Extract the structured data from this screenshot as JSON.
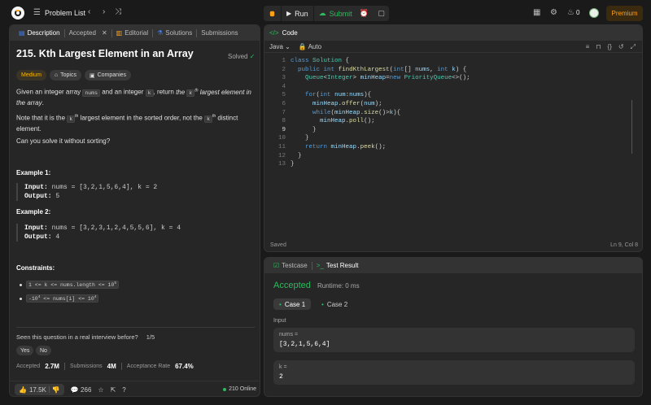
{
  "topbar": {
    "problem_list": "Problem List",
    "run": "Run",
    "submit": "Submit",
    "streak": "0",
    "premium": "Premium"
  },
  "description": {
    "tabs": [
      {
        "label": "Description"
      },
      {
        "label": "Accepted"
      },
      {
        "label": "Editorial"
      },
      {
        "label": "Solutions"
      },
      {
        "label": "Submissions"
      }
    ],
    "title": "215. Kth Largest Element in an Array",
    "solved": "Solved",
    "difficulty": "Medium",
    "topics": "Topics",
    "companies": "Companies",
    "para1_a": "Given an integer array ",
    "para1_code1": "nums",
    "para1_b": " and an integer ",
    "para1_code2": "k",
    "para1_c": ", return ",
    "para1_d": "the ",
    "para1_code3": "k",
    "para1_sup": "th",
    "para1_e": " largest element in the array",
    "para1_f": ".",
    "para2_a": "Note that it is the ",
    "para2_code": "k",
    "para2_sup": "th",
    "para2_b": " largest element in the sorted order, not the ",
    "para2_code2": "k",
    "para2_sup2": "th",
    "para2_c": " distinct element.",
    "para3": "Can you solve it without sorting?",
    "example1_title": "Example 1:",
    "example1_input_label": "Input:",
    "example1_input": " nums = [3,2,1,5,6,4], k = 2",
    "example1_output_label": "Output:",
    "example1_output": " 5",
    "example2_title": "Example 2:",
    "example2_input_label": "Input:",
    "example2_input": " nums = [3,2,3,1,2,4,5,5,6], k = 4",
    "example2_output_label": "Output:",
    "example2_output": " 4",
    "constraints_title": "Constraints:",
    "constraint1_a": "1 <= k <= nums.length <= 10",
    "constraint1_sup": "5",
    "constraint2_a": "-10",
    "constraint2_sup1": "4",
    "constraint2_b": " <= nums[i] <= 10",
    "constraint2_sup2": "4",
    "interview_q": "Seen this question in a real interview before?",
    "interview_count": "1/5",
    "yes": "Yes",
    "no": "No",
    "accepted_label": "Accepted",
    "accepted_value": "2.7M",
    "submissions_label": "Submissions",
    "submissions_value": "4M",
    "acceptance_label": "Acceptance Rate",
    "acceptance_value": "67.4%",
    "likes": "17.5K",
    "comments": "266",
    "online": "210 Online"
  },
  "code": {
    "header": "Code",
    "language": "Java",
    "auto": "Auto",
    "line_numbers": [
      "1",
      "2",
      "3",
      "4",
      "5",
      "6",
      "7",
      "8",
      "9",
      "10",
      "11",
      "12",
      "13"
    ],
    "status_left": "Saved",
    "status_right": "Ln 9, Col 8"
  },
  "result": {
    "tab_testcase": "Testcase",
    "tab_result": "Test Result",
    "status": "Accepted",
    "runtime": "Runtime: 0 ms",
    "case1": "Case 1",
    "case2": "Case 2",
    "input_label": "Input",
    "nums_label": "nums =",
    "nums_value": "[3,2,1,5,6,4]",
    "k_label": "k =",
    "k_value": "2"
  },
  "colors": {
    "accent_green": "#2cbb5d",
    "premium_orange": "#ffa116",
    "medium_yellow": "#ffb800"
  }
}
